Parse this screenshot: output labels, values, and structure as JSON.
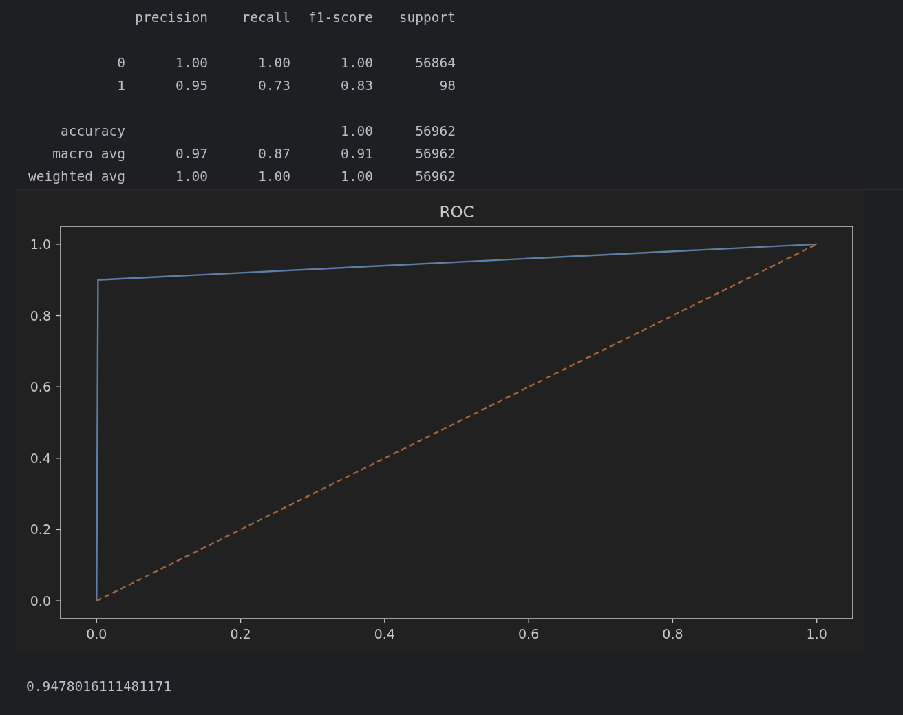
{
  "report": {
    "columns": [
      "precision",
      "recall",
      "f1-score",
      "support"
    ],
    "class_rows": [
      {
        "label": "0",
        "cells": [
          "1.00",
          "1.00",
          "1.00",
          "56864"
        ]
      },
      {
        "label": "1",
        "cells": [
          "0.95",
          "0.73",
          "0.83",
          "98"
        ]
      }
    ],
    "summary_rows": [
      {
        "label": "accuracy",
        "cells": [
          "",
          "",
          "1.00",
          "56962"
        ]
      },
      {
        "label": "macro avg",
        "cells": [
          "0.97",
          "0.87",
          "0.91",
          "56962"
        ]
      },
      {
        "label": "weighted avg",
        "cells": [
          "1.00",
          "1.00",
          "1.00",
          "56962"
        ]
      }
    ]
  },
  "chart": {
    "chart_data": {
      "type": "line",
      "title": "ROC",
      "x": [
        0,
        0.002,
        1
      ],
      "series": [
        {
          "color": "#5b7fa8",
          "values": [
            0,
            0.9,
            1
          ],
          "line_style": "solid"
        },
        {
          "color": "#a8663d",
          "values": [
            0,
            0.002,
            1
          ],
          "line_style": "dashed"
        }
      ],
      "xlim": [
        -0.05,
        1.05
      ],
      "ylim": [
        -0.05,
        1.05
      ],
      "xticks": [
        {
          "value": 0,
          "label": "0.0"
        },
        {
          "value": 0.2,
          "label": "0.2"
        },
        {
          "value": 0.4,
          "label": "0.4"
        },
        {
          "value": 0.6,
          "label": "0.6"
        },
        {
          "value": 0.8,
          "label": "0.8"
        },
        {
          "value": 1,
          "label": "1.0"
        }
      ],
      "yticks": [
        {
          "value": 0,
          "label": "0.0"
        },
        {
          "value": 0.2,
          "label": "0.2"
        },
        {
          "value": 0.4,
          "label": "0.4"
        },
        {
          "value": 0.6,
          "label": "0.6"
        },
        {
          "value": 0.8,
          "label": "0.8"
        },
        {
          "value": 1,
          "label": "1.0"
        }
      ]
    }
  },
  "result": "0.9478016111481171"
}
